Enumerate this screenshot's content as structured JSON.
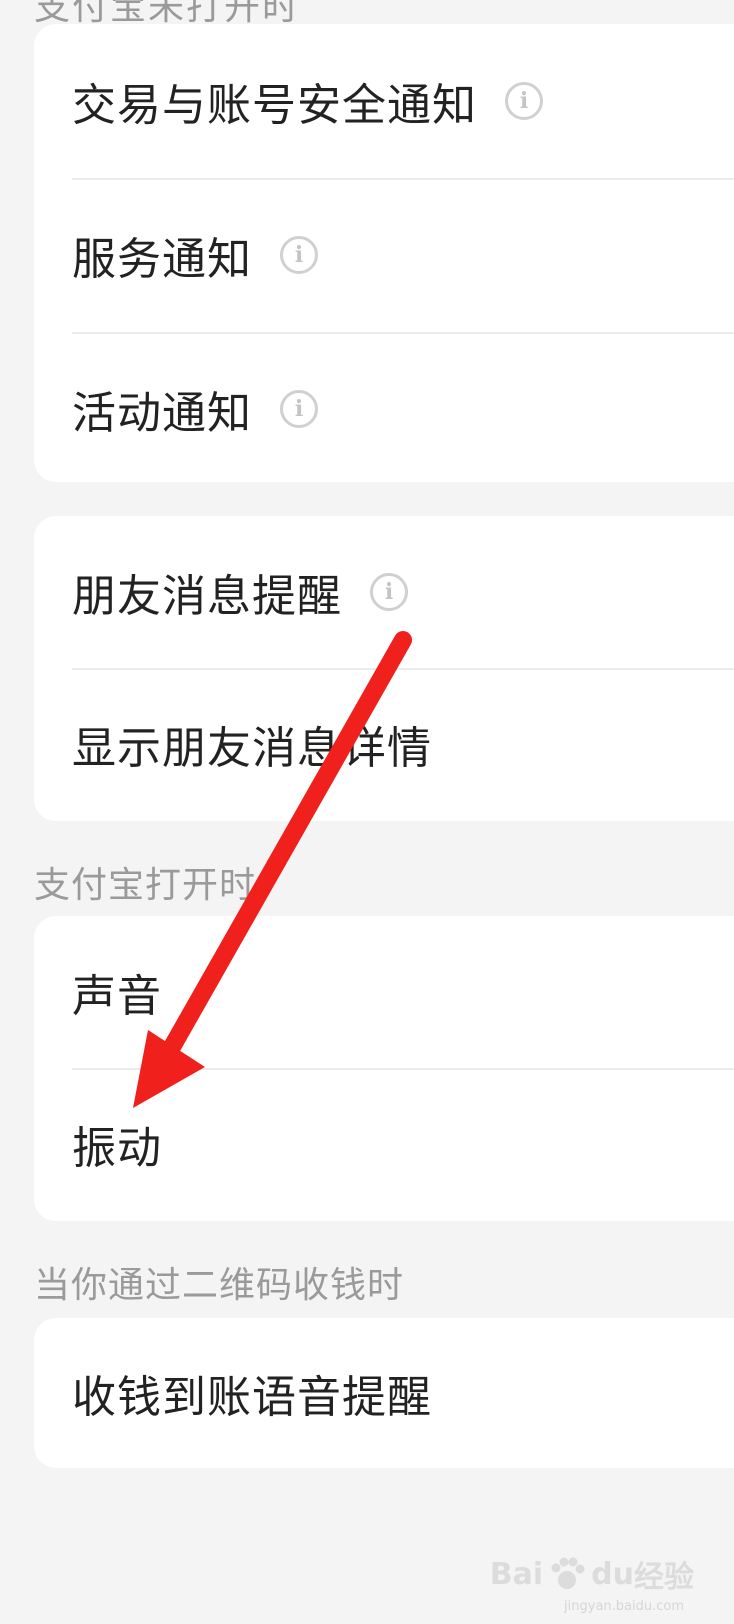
{
  "section1": {
    "title": "支付宝未打开时",
    "items": [
      {
        "label": "交易与账号安全通知",
        "info": true
      },
      {
        "label": "服务通知",
        "info": true
      },
      {
        "label": "活动通知",
        "info": true
      }
    ]
  },
  "section2": {
    "items": [
      {
        "label": "朋友消息提醒",
        "info": true
      },
      {
        "label": "显示朋友消息详情",
        "info": false
      }
    ]
  },
  "section3": {
    "header": "支付宝打开时",
    "items": [
      {
        "label": "声音"
      },
      {
        "label": "振动"
      }
    ]
  },
  "section4": {
    "header": "当你通过二维码收钱时",
    "items": [
      {
        "label": "收钱到账语音提醒"
      }
    ]
  },
  "info_icon_glyph": "i",
  "annotation": {
    "color": "#f0201c"
  },
  "watermark": {
    "brand_left": "Bai",
    "brand_right": "du",
    "suffix": "经验",
    "url": "jingyan.baidu.com"
  }
}
